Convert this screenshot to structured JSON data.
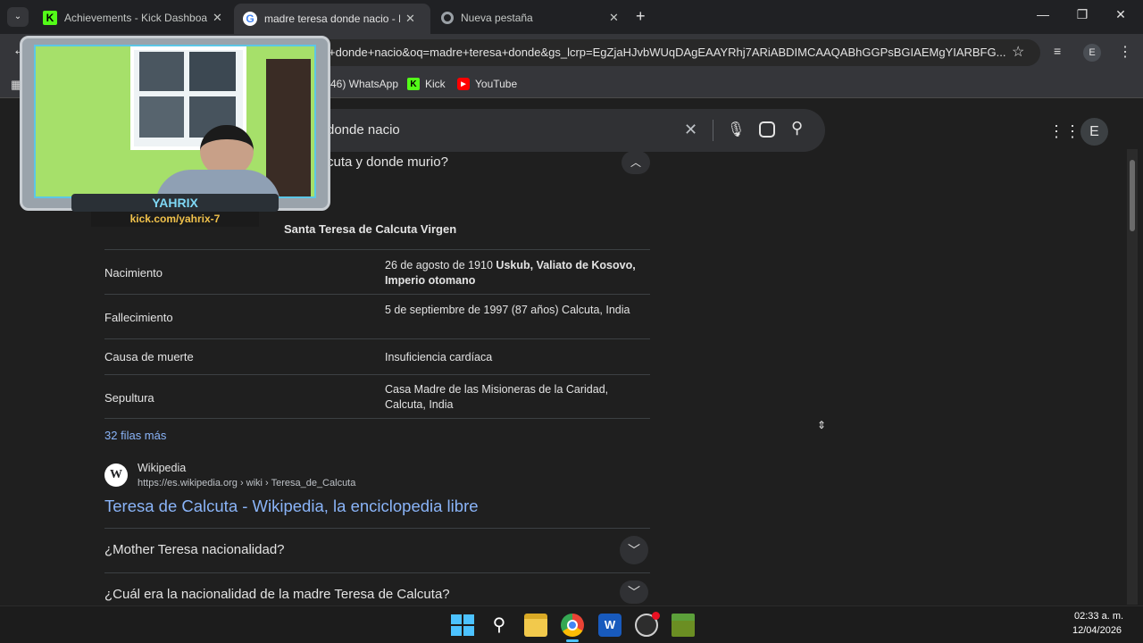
{
  "tabs": [
    {
      "title": "Achievements - Kick Dashboard",
      "favicon": "kick-icon",
      "active": false
    },
    {
      "title": "madre teresa donde nacio - Bu",
      "favicon": "google-icon",
      "active": true
    },
    {
      "title": "Nueva pestaña",
      "favicon": "chrome-icon",
      "active": false
    }
  ],
  "omnibox": {
    "url": "+donde+nacio&oq=madre+teresa+donde&gs_lcrp=EgZjaHJvbWUqDAgEAAYRhj7ARiABDIMCAAQABhGGPsBGIAEMgYIARBFG..."
  },
  "profile_letter": "E",
  "bookmarks": [
    {
      "label": "(46) WhatsApp",
      "icon": "whatsapp-icon"
    },
    {
      "label": "Kick",
      "icon": "kick-icon"
    },
    {
      "label": "YouTube",
      "icon": "youtube-icon"
    }
  ],
  "search": {
    "query": "donde nacio"
  },
  "question_partial": "cuta y donde murio?",
  "infobox": {
    "title": "Santa Teresa de Calcuta Virgen",
    "rows": [
      {
        "label": "Nacimiento",
        "value_plain": "26 de agosto de 1910 ",
        "value_bold": "Uskub, Valiato de Kosovo, Imperio otomano"
      },
      {
        "label": "Fallecimiento",
        "value_plain": "5 de septiembre de 1997 (87 años) Calcuta, India",
        "value_bold": ""
      },
      {
        "label": "Causa de muerte",
        "value_plain": "Insuficiencia cardíaca",
        "value_bold": ""
      },
      {
        "label": "Sepultura",
        "value_plain": "Casa Madre de las Misioneras de la Caridad, Calcuta, India",
        "value_bold": ""
      }
    ],
    "more_rows": "32 filas más"
  },
  "source": {
    "site_name": "Wikipedia",
    "url": "https://es.wikipedia.org › wiki › Teresa_de_Calcuta",
    "link_title": "Teresa de Calcuta - Wikipedia, la enciclopedia libre",
    "favicon_letter": "W"
  },
  "faqs": [
    {
      "question": "¿Mother Teresa nacionalidad?"
    },
    {
      "question": "¿Cuál era la nacionalidad de la madre Teresa de Calcuta?"
    }
  ],
  "webcam": {
    "name": "YAHRIX",
    "url": "kick.com/yahrix-7"
  },
  "clock": {
    "time": "02:33 a. m.",
    "date": "12/04/2026"
  },
  "colors": {
    "link": "#8ab4f8",
    "background": "#1f1f1f",
    "kick_green": "#53fc18"
  }
}
